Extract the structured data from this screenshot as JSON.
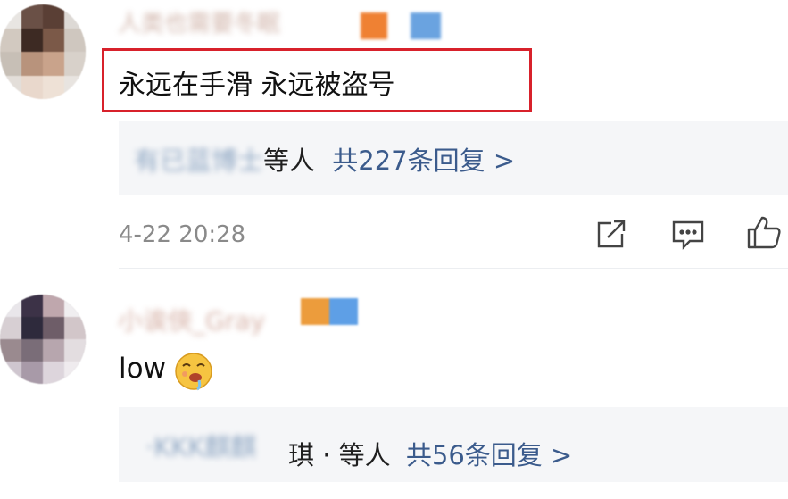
{
  "comment1": {
    "author_blurred": "人类也需要冬眠",
    "text": "永远在手滑 永远被盗号",
    "replies": {
      "names_blurred": "有已蓝博士",
      "suffix": "等人",
      "count_text": "共227条回复 >"
    },
    "time": "4-22 20:28"
  },
  "comment2": {
    "author_blurred": "小诶俠_Gray",
    "text": "low",
    "emoji": "drooling-face-emoji",
    "replies": {
      "names_blurred": "·KKK麒麒",
      "names_tail": "琪 ·",
      "suffix": "等人",
      "count_text": "共56条回复 >"
    }
  },
  "icons": {
    "share": "share-icon",
    "comment": "comment-icon",
    "like": "thumbs-up-icon"
  },
  "colors": {
    "highlight_border": "#d8212b",
    "link": "#3b5b8c",
    "reply_bg": "#f5f6f8"
  }
}
